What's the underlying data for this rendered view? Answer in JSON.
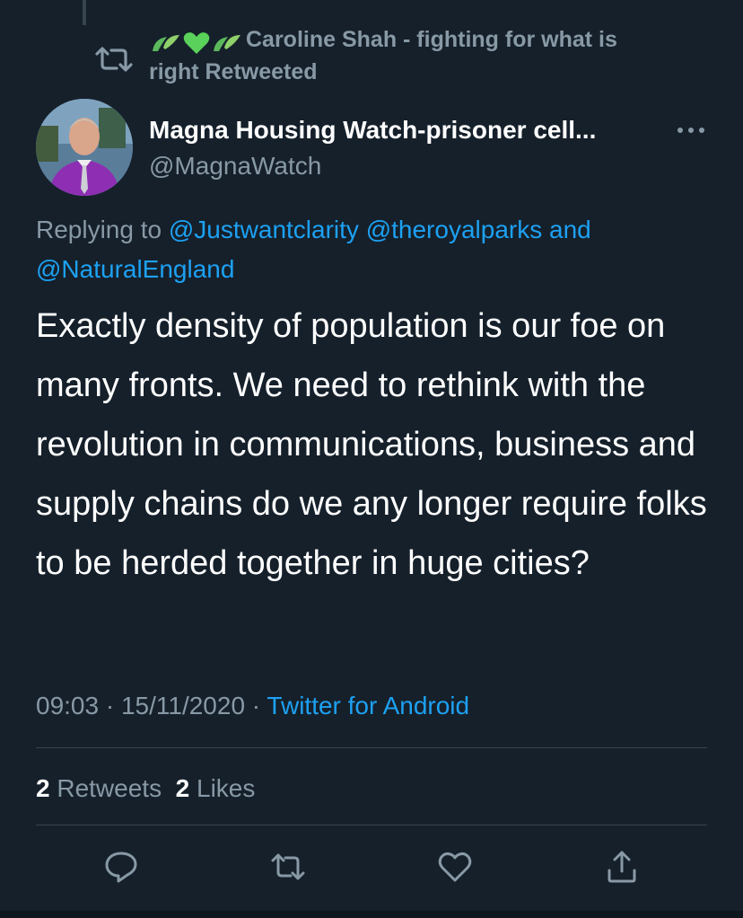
{
  "retweet_banner": {
    "text_line1": "Caroline Shah - fighting for what is",
    "text_line2": "right Retweeted",
    "icon": "retweet-icon",
    "emoji_icons": [
      "leaf-icon",
      "green-heart-icon",
      "leaf-icon"
    ]
  },
  "author": {
    "display_name": "Magna Housing Watch-prisoner cell...",
    "handle": "@MagnaWatch",
    "avatar": "profile-photo"
  },
  "reply_context": {
    "prefix": "Replying to ",
    "mention1": "@Justwantclarity",
    "mention2": "@theroyalparks",
    "joiner": " and",
    "mention3": "@NaturalEngland"
  },
  "tweet": {
    "text": "Exactly density of population is our foe on many fronts. We need to rethink with the revolution in communications, business and supply chains do we any longer require folks to be herded together in huge cities?"
  },
  "meta": {
    "time": "09:03",
    "date": "15/11/2020",
    "separator": " · ",
    "source": "Twitter for Android"
  },
  "stats": {
    "retweets_count": "2",
    "retweets_label": "Retweets",
    "likes_count": "2",
    "likes_label": "Likes"
  },
  "actions": [
    "reply-icon",
    "retweet-icon",
    "like-icon",
    "share-icon"
  ],
  "colors": {
    "background": "#15202b",
    "secondary_text": "#8899a6",
    "link": "#1da1f2",
    "divider": "#38444d"
  }
}
